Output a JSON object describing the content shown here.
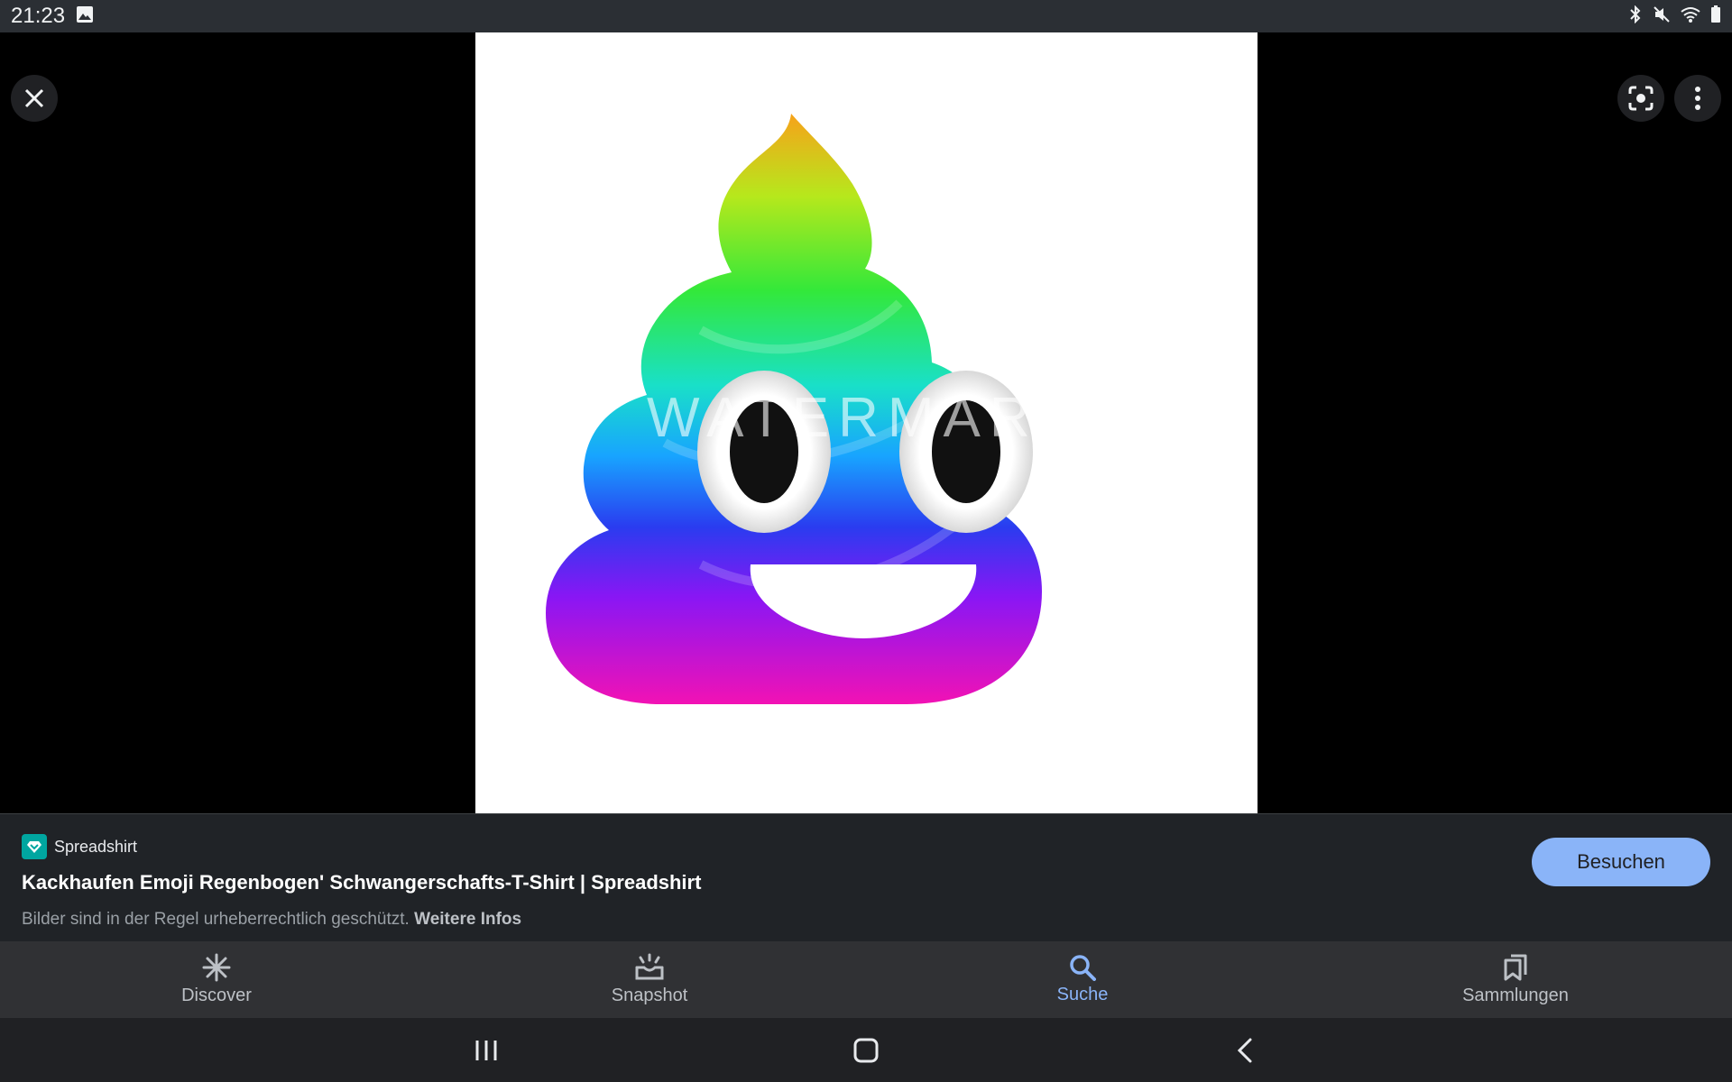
{
  "statusbar": {
    "time": "21:23",
    "icons": [
      "gallery-notification-icon",
      "bluetooth-icon",
      "mute-icon",
      "wifi-icon",
      "battery-icon"
    ]
  },
  "viewer": {
    "close_icon": "close-icon",
    "lens_icon": "lens-icon",
    "more_icon": "more-vert-icon",
    "image_watermark": "WATERMARK"
  },
  "result": {
    "source_name": "Spreadshirt",
    "title": "Kackhaufen Emoji Regenbogen' Schwangerschafts-T-Shirt | Spreadshirt",
    "copyright_text": "Bilder sind in der Regel urheberrechtlich geschützt.",
    "more_info_link": "Weitere Infos",
    "visit_button": "Besuchen"
  },
  "bottom_nav": {
    "items": [
      {
        "label": "Discover",
        "icon": "discover-asterisk-icon",
        "active": false
      },
      {
        "label": "Snapshot",
        "icon": "snapshot-icon",
        "active": false
      },
      {
        "label": "Suche",
        "icon": "search-icon",
        "active": true
      },
      {
        "label": "Sammlungen",
        "icon": "collections-icon",
        "active": false
      }
    ]
  },
  "system_nav": {
    "recents_icon": "recents-icon",
    "home_icon": "home-icon",
    "back_icon": "back-icon"
  },
  "colors": {
    "accent": "#8ab4f8",
    "panel_bg": "#202327",
    "nav_bg": "#303134"
  }
}
